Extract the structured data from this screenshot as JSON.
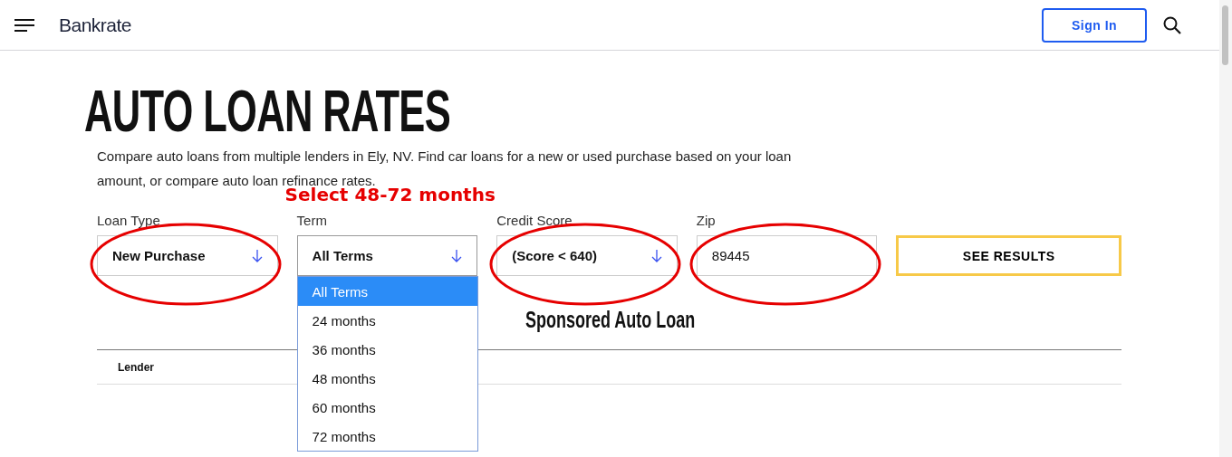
{
  "header": {
    "logo": "Bankrate",
    "sign_in": "Sign In"
  },
  "title": "AUTO LOAN RATES",
  "description": "Compare auto loans from multiple lenders in Ely, NV. Find car loans for a new or used purchase based on your loan amount, or compare auto loan refinance rates.",
  "annotation": "Select 48-72 months",
  "fields": [
    {
      "kind": "select",
      "label": "Loan Type",
      "value": "New Purchase",
      "circled": true,
      "expanded": false
    },
    {
      "kind": "select",
      "label": "Term",
      "value": "All Terms",
      "circled": false,
      "expanded": true,
      "options": [
        {
          "label": "All Terms",
          "selected": true
        },
        {
          "label": "24 months",
          "selected": false
        },
        {
          "label": "36 months",
          "selected": false
        },
        {
          "label": "48 months",
          "selected": false
        },
        {
          "label": "60 months",
          "selected": false
        },
        {
          "label": "72 months",
          "selected": false
        }
      ]
    },
    {
      "kind": "select",
      "label": "Credit Score",
      "value": "(Score < 640)",
      "circled": true,
      "expanded": false
    },
    {
      "kind": "input",
      "label": "Zip",
      "value": "89445",
      "circled": true
    }
  ],
  "submit": "SEE RESULTS",
  "sponsored_heading": "Sponsored Auto Loan",
  "table": {
    "columns": [
      "Lender"
    ]
  }
}
